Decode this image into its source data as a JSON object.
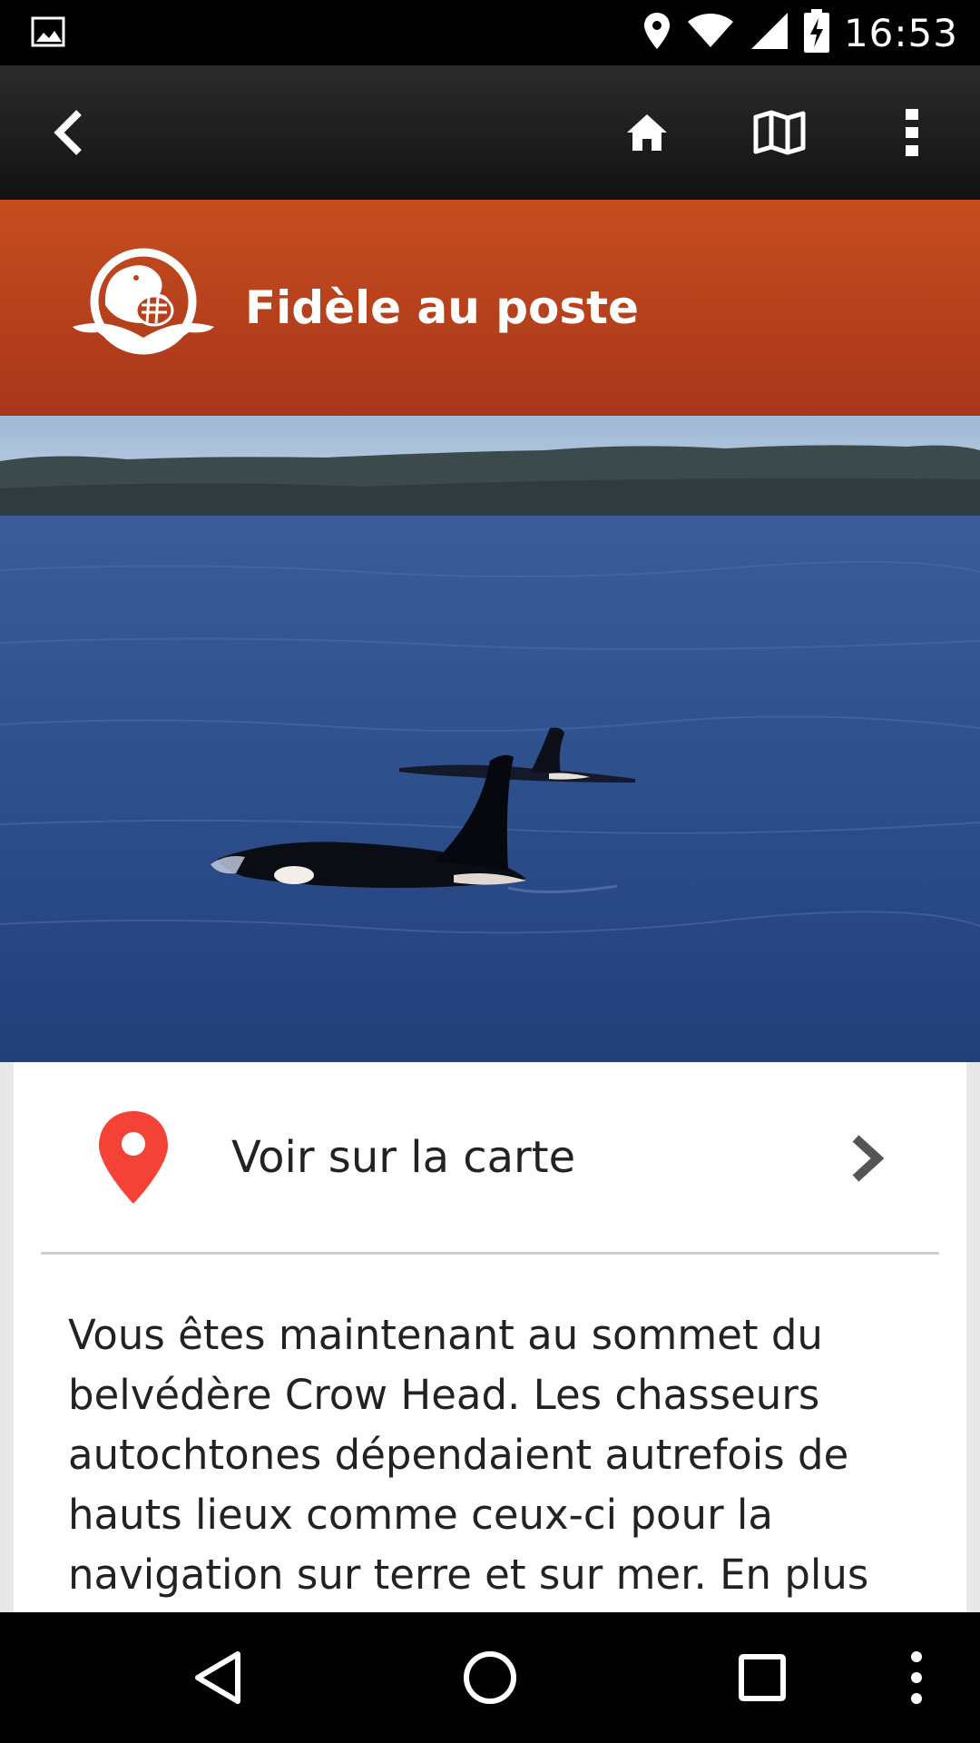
{
  "status_bar": {
    "time": "16:53",
    "icons": [
      "image-notification-icon",
      "location-icon",
      "wifi-icon",
      "cell-signal-icon",
      "battery-charging-icon"
    ]
  },
  "app_bar": {
    "icons": [
      "back-icon",
      "home-icon",
      "map-icon",
      "overflow-menu-icon"
    ]
  },
  "banner": {
    "title": "Fidèle au poste",
    "logo": "parks-canada-beaver-logo"
  },
  "hero": {
    "image": "orcas-swimming-in-bay"
  },
  "map_link": {
    "label": "Voir sur la carte",
    "icon": "map-pin-icon",
    "pin_color": "#f44336"
  },
  "description": "Vous êtes maintenant au sommet du belvédère Crow Head. Les chasseurs autochtones dépendaient autrefois de hauts lieux comme ceux-ci pour la navigation sur terre et sur mer. En plus",
  "nav_bar": {
    "icons": [
      "nav-back-icon",
      "nav-home-icon",
      "nav-recents-icon",
      "nav-menu-icon"
    ]
  },
  "colors": {
    "banner": "#b8401c",
    "app_bar": "#1e1e1e"
  }
}
